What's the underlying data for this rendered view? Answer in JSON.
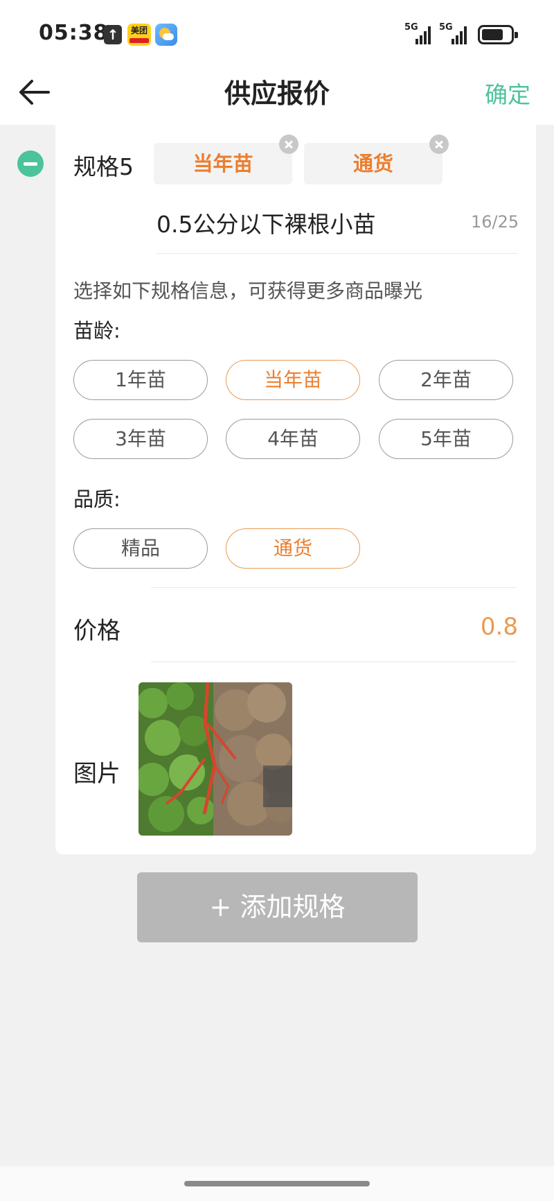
{
  "status_bar": {
    "time": "05:38",
    "meituan_label": "美团",
    "signal_1_label": "5G",
    "signal_2_label": "5G",
    "icons": [
      "upload-arrow-icon",
      "meituan-app-icon",
      "weather-app-icon",
      "signal-5g-icon",
      "signal-5g-icon",
      "battery-icon"
    ]
  },
  "header": {
    "back_icon": "arrow-left-icon",
    "title": "供应报价",
    "confirm_label": "确定",
    "accent_color": "#4cc39b"
  },
  "spec": {
    "label": "规格5",
    "remove_icon": "minus-circle-icon",
    "tags": [
      {
        "label": "当年苗",
        "remove_icon": "close-circle-icon"
      },
      {
        "label": "通货",
        "remove_icon": "close-circle-icon"
      }
    ],
    "name_value": "0.5公分以下裸根小苗",
    "name_count": "16/25",
    "hint": "选择如下规格信息，可获得更多商品曝光",
    "age": {
      "label": "苗龄:",
      "options": [
        {
          "label": "1年苗",
          "selected": false
        },
        {
          "label": "当年苗",
          "selected": true
        },
        {
          "label": "2年苗",
          "selected": false
        },
        {
          "label": "3年苗",
          "selected": false
        },
        {
          "label": "4年苗",
          "selected": false
        },
        {
          "label": "5年苗",
          "selected": false
        }
      ]
    },
    "quality": {
      "label": "品质:",
      "options": [
        {
          "label": "精品",
          "selected": false
        },
        {
          "label": "通货",
          "selected": true
        }
      ]
    },
    "price_label": "价格",
    "price_value": "0.8",
    "images_label": "图片",
    "highlight_color": "#ec7e2f"
  },
  "add_spec_label": "+ 添加规格"
}
